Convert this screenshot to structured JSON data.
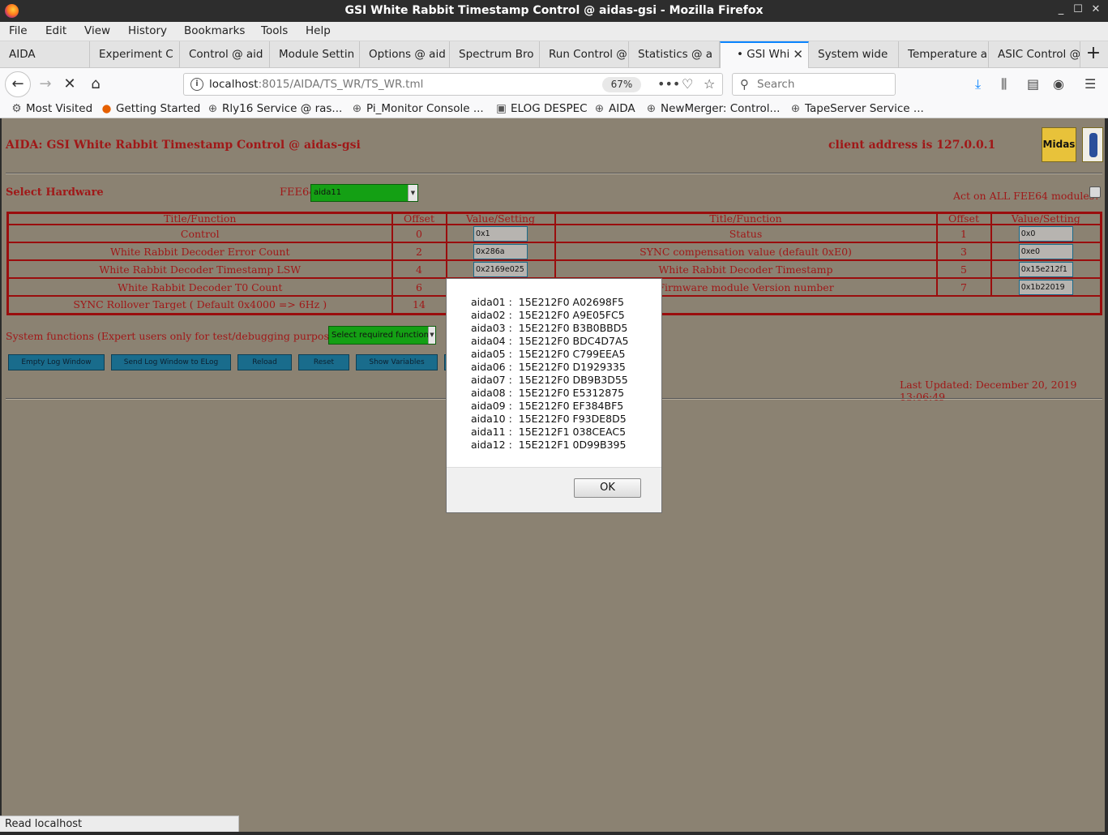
{
  "window": {
    "title": "GSI White Rabbit Timestamp Control @ aidas-gsi - Mozilla Firefox",
    "controls": [
      "_",
      "☐",
      "✕"
    ]
  },
  "menu": [
    "File",
    "Edit",
    "View",
    "History",
    "Bookmarks",
    "Tools",
    "Help"
  ],
  "tabs": [
    {
      "label": "AIDA"
    },
    {
      "label": "Experiment C"
    },
    {
      "label": "Control @ aid"
    },
    {
      "label": "Module Settin"
    },
    {
      "label": "Options @ aid"
    },
    {
      "label": "Spectrum Bro"
    },
    {
      "label": "Run Control @"
    },
    {
      "label": "Statistics @ a"
    },
    {
      "label": "• GSI Whi",
      "active": true
    },
    {
      "label": "System wide"
    },
    {
      "label": "Temperature a"
    },
    {
      "label": "ASIC Control @"
    }
  ],
  "nav": {
    "url_host": "localhost",
    "url_path": ":8015/AIDA/TS_WR/TS_WR.tml",
    "zoom": "67%",
    "search_placeholder": "Search"
  },
  "bookmarks": [
    {
      "label": "Most Visited",
      "icon": "gear-icon"
    },
    {
      "label": "Getting Started",
      "icon": "firefox-icon"
    },
    {
      "label": "Rly16 Service @ ras...",
      "icon": "globe-icon"
    },
    {
      "label": "Pi_Monitor Console ...",
      "icon": "globe-icon"
    },
    {
      "label": "ELOG DESPEC",
      "icon": "elog-icon"
    },
    {
      "label": "AIDA",
      "icon": "globe-icon"
    },
    {
      "label": "NewMerger: Control...",
      "icon": "globe-icon"
    },
    {
      "label": "TapeServer Service ...",
      "icon": "globe-icon"
    }
  ],
  "page": {
    "title": "AIDA: GSI White Rabbit Timestamp Control @ aidas-gsi",
    "client": "client address is 127.0.0.1",
    "logo_text": "Midas",
    "select_hardware": "Select Hardware",
    "fee_label": "FEE64",
    "fee_value": "aida11",
    "act_all": "Act on ALL FEE64 modules?",
    "table_headers": [
      "Title/Function",
      "Offset",
      "Value/Setting",
      "Title/Function",
      "Offset",
      "Value/Setting"
    ],
    "rows": [
      {
        "l_title": "Control",
        "l_off": "0",
        "l_val": "0x1",
        "r_title": "Status",
        "r_off": "1",
        "r_val": "0x0"
      },
      {
        "l_title": "White Rabbit Decoder Error Count",
        "l_off": "2",
        "l_val": "0x286a",
        "r_title": "SYNC compensation value (default 0xE0)",
        "r_off": "3",
        "r_val": "0xe0"
      },
      {
        "l_title": "White Rabbit Decoder Timestamp LSW",
        "l_off": "4",
        "l_val": "0x2169e025",
        "r_title": "White Rabbit Decoder Timestamp",
        "r_off": "5",
        "r_val": "0x15e212f1"
      },
      {
        "l_title": "White Rabbit Decoder T0 Count",
        "l_off": "6",
        "l_val": "",
        "r_title": "Firmware module Version number",
        "r_off": "7",
        "r_val": "0x1b22019"
      },
      {
        "l_title": "SYNC Rollover Target ( Default 0x4000 => 6Hz )",
        "l_off": "14",
        "l_val": "",
        "r_title": "",
        "r_off": "",
        "r_val": ""
      }
    ],
    "sys_functions": "System functions (Expert users only for test/debugging purposes!!!)",
    "sys_select": "Select required function",
    "buttons": [
      "Empty Log Window",
      "Send Log Window to ELog",
      "Reload",
      "Reset",
      "Show Variables"
    ],
    "last_updated": "Last Updated: December 20, 2019 13:06:49"
  },
  "modal": {
    "lines": [
      "aida01 :  15E212F0 A02698F5",
      "aida02 :  15E212F0 A9E05FC5",
      "aida03 :  15E212F0 B3B0BBD5",
      "aida04 :  15E212F0 BDC4D7A5",
      "aida05 :  15E212F0 C799EEA5",
      "aida06 :  15E212F0 D1929335",
      "aida07 :  15E212F0 DB9B3D55",
      "aida08 :  15E212F0 E5312875",
      "aida09 :  15E212F0 EF384BF5",
      "aida10 :  15E212F0 F93DE8D5",
      "aida11 :  15E212F1 038CEAC5",
      "aida12 :  15E212F1 0D99B395"
    ],
    "ok": "OK"
  },
  "status": "Read localhost"
}
